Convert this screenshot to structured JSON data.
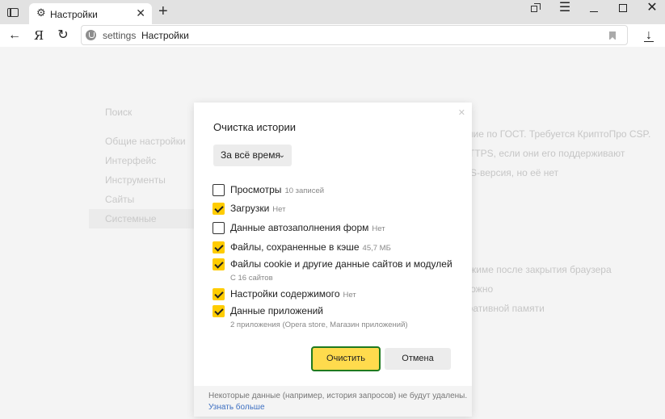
{
  "browser": {
    "tab_title": "Настройки",
    "address_host": "settings",
    "address_title": "Настройки",
    "yandex_button": "Я"
  },
  "settings_page": {
    "search_placeholder": "Поиск",
    "nav": [
      "Общие настройки",
      "Интерфейс",
      "Инструменты",
      "Сайты",
      "Системные"
    ],
    "background_lines": [
      "вание по ГОСТ. Требуется КриптоПро CSP.",
      "TTPS, если они его поддерживают",
      "S-версия, но её нет",
      "режиме после закрытия браузера",
      "можно",
      "еративной памяти"
    ]
  },
  "dialog": {
    "title": "Очистка истории",
    "period": "За всё время",
    "options": [
      {
        "label": "Просмотры",
        "note": "10 записей",
        "checked": false
      },
      {
        "label": "Загрузки",
        "note": "Нет",
        "checked": true
      },
      {
        "label": "Данные автозаполнения форм",
        "note": "Нет",
        "checked": false
      },
      {
        "label": "Файлы, сохраненные в кэше",
        "note": "45,7 МБ",
        "checked": true
      },
      {
        "label": "Файлы cookie и другие данные сайтов и модулей",
        "sub": "С 16 сайтов",
        "checked": true
      },
      {
        "label": "Настройки содержимого",
        "note": "Нет",
        "checked": true
      },
      {
        "label": "Данные приложений",
        "sub": "2 приложения (Opera store, Магазин приложений)",
        "checked": true
      }
    ],
    "clear_button": "Очистить",
    "cancel_button": "Отмена",
    "footer_note": "Некоторые данные (например, история запросов) не будут удалены.",
    "footer_link": "Узнать больше"
  },
  "colors": {
    "accent": "#ffdb4d",
    "checkbox_checked": "#ffcc00",
    "focus_ring": "#1f7a1f",
    "link": "#3d6fc1"
  }
}
